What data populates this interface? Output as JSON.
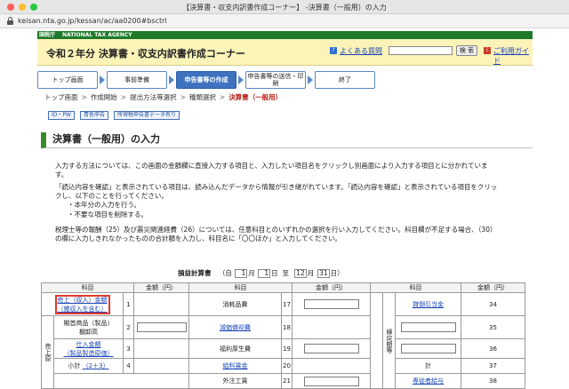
{
  "window": {
    "title": "【決算書・収支内訳書作成コーナー】 -決算書（一般用）の入力",
    "url": "keisan.nta.go.jp/kessan/ac/aa0200#bsctrl"
  },
  "header": {
    "agency_badge": "国税庁",
    "agency_en": "NATIONAL TAX AGENCY",
    "corner_title": "令和２年分 決算書・収支内訳書作成コーナー",
    "faq_link": "よくある質問",
    "search_button": "検 索",
    "usage_link": "ご利用ガイド",
    "faq_icon": "question-icon",
    "usage_icon": "guide-icon"
  },
  "steps": [
    {
      "label": "トップ画面"
    },
    {
      "label": "事前準備"
    },
    {
      "label": "申告書等の作成"
    },
    {
      "label": "申告書等の送信・印刷"
    },
    {
      "label": "終了"
    }
  ],
  "breadcrumb": {
    "items": [
      "トップ画面",
      "作成開始",
      "提出方法等選択",
      "種類選択"
    ],
    "current": "決算書（一般用）"
  },
  "tags": [
    "ID・PW",
    "青色申告",
    "所得税申告書データ有り"
  ],
  "section_title": "決算書（一般用）の入力",
  "paragraphs": {
    "p1": "入力する方法については、この画面の金額欄に直接入力する項目と、入力したい項目名をクリックし別画面により入力する項目とに分かれています。",
    "p2": "「読込内容を確認」と表示されている項目は、読み込んだデータから情報が引き継がれています。「読込内容を確認」と表示されている項目をクリックし、以下のことを行ってください。",
    "bullet1": "・本年分の入力を行う。",
    "bullet2": "・不要な項目を削除する。",
    "p3": "税理士等の報酬（25）及び震災関連経費（26）については、任意科目とのいずれかの選択を行い入力してください。科目欄が不足する場合、（30）の欄に入力しきれなかったものの合計額を入力し、科目名に「〇〇ほか」と入力してください。"
  },
  "statement": {
    "title": "損益計算書",
    "open_paren": "（自",
    "from_month": "1",
    "month": "月",
    "from_day": "1",
    "day": "日",
    "to": "至",
    "to_month": "12",
    "to_day": "31",
    "close_paren": "日）"
  },
  "table": {
    "headers": {
      "kamoku": "科目",
      "kingaku": "金額（円）"
    },
    "left_label": "売上原",
    "mid_label": "経費",
    "right_label": "繰戻額等",
    "col1": [
      {
        "label": "売上（収入）金額",
        "sub": "（雑収入を含む）",
        "no": "1",
        "link": true
      },
      {
        "label": "期首商品（製品）",
        "sub": "棚卸高",
        "no": "2",
        "link": false
      },
      {
        "label": "仕入金額",
        "sub": "（製品製造原価）",
        "no": "3",
        "link": true
      },
      {
        "label": "小計",
        "sub": "（2＋3）",
        "no": "4",
        "link": false
      }
    ],
    "col2": [
      {
        "label": "消耗品費",
        "no": "17",
        "link": false
      },
      {
        "label": "減価償却費",
        "no": "18",
        "link": true
      },
      {
        "label": "福利厚生費",
        "no": "19",
        "link": false
      },
      {
        "label": "給料賃金",
        "no": "20",
        "link": true
      },
      {
        "label": "外注工賃",
        "no": "21",
        "link": false
      }
    ],
    "col3": [
      {
        "label": "貸倒引当金",
        "no": "34",
        "link": true
      },
      {
        "label": "",
        "no": "35",
        "link": false
      },
      {
        "label": "",
        "no": "36",
        "link": false
      },
      {
        "label": "計",
        "no": "37",
        "link": false
      },
      {
        "label": "専従者給与",
        "no": "38",
        "link": true
      }
    ]
  }
}
